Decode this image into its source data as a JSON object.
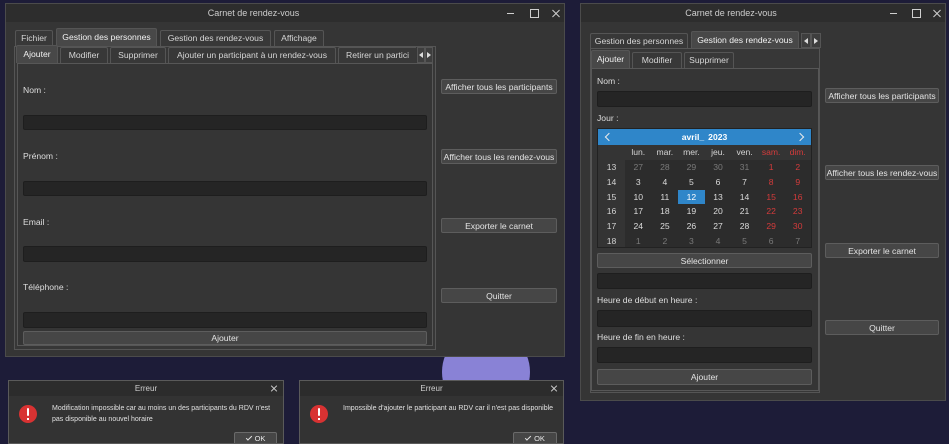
{
  "colors": {
    "accent": "#2f86c9",
    "weekend": "#d43b3b",
    "error": "#d83232",
    "desktop": "#1d1c38",
    "wallpaper_shape": "#8982d6"
  },
  "windows": {
    "left": {
      "title": "Carnet de rendez-vous",
      "controls": [
        "minimize-icon",
        "maximize-icon",
        "close-icon"
      ],
      "tabs": [
        {
          "label": "Fichier"
        },
        {
          "label": "Gestion des personnes",
          "selected": true
        },
        {
          "label": "Gestion des rendez-vous"
        },
        {
          "label": "Affichage"
        }
      ],
      "subtabs": [
        {
          "label": "Ajouter",
          "selected": true
        },
        {
          "label": "Modifier"
        },
        {
          "label": "Supprimer"
        },
        {
          "label": "Ajouter un participant à un rendez-vous"
        },
        {
          "label": "Retirer un partici"
        }
      ],
      "tab_scroll_icons": [
        "arrow-left-icon",
        "arrow-right-icon"
      ],
      "form": {
        "fields": [
          {
            "label": "Nom :"
          },
          {
            "label": "Prénom :"
          },
          {
            "label": "Email :"
          },
          {
            "label": "Téléphone :"
          }
        ],
        "submit_label": "Ajouter"
      },
      "side_buttons": [
        "Afficher tous les participants",
        "Afficher tous les rendez-vous",
        "Exporter le carnet",
        "Quitter"
      ]
    },
    "right": {
      "title": "Carnet de rendez-vous",
      "controls": [
        "minimize-icon",
        "maximize-icon",
        "close-icon"
      ],
      "tabs": [
        {
          "label": "Gestion des personnes"
        },
        {
          "label": "Gestion des rendez-vous",
          "selected": true
        }
      ],
      "tab_scroll_icons": [
        "arrow-left-icon",
        "arrow-right-icon"
      ],
      "subtabs": [
        {
          "label": "Ajouter",
          "selected": true
        },
        {
          "label": "Modifier"
        },
        {
          "label": "Supprimer"
        }
      ],
      "form": {
        "name_label": "Nom :",
        "day_label": "Jour :",
        "select_button": "Sélectionner",
        "start_label": "Heure de début en heure :",
        "end_label": "Heure de fin en heure :",
        "submit_label": "Ajouter"
      },
      "calendar": {
        "month": "avril_",
        "year": "2023",
        "nav_icons": [
          "chevron-left-icon",
          "chevron-right-icon"
        ],
        "weekdays": [
          "lun.",
          "mar.",
          "mer.",
          "jeu.",
          "ven.",
          "sam.",
          "dim."
        ],
        "weeks": [
          {
            "number": "13",
            "days": [
              {
                "d": "27",
                "state": "other"
              },
              {
                "d": "28",
                "state": "other"
              },
              {
                "d": "29",
                "state": "other"
              },
              {
                "d": "30",
                "state": "other"
              },
              {
                "d": "31",
                "state": "other"
              },
              {
                "d": "1",
                "state": "weekend"
              },
              {
                "d": "2",
                "state": "weekend"
              }
            ]
          },
          {
            "number": "14",
            "days": [
              {
                "d": "3"
              },
              {
                "d": "4"
              },
              {
                "d": "5"
              },
              {
                "d": "6"
              },
              {
                "d": "7"
              },
              {
                "d": "8",
                "state": "weekend"
              },
              {
                "d": "9",
                "state": "weekend"
              }
            ]
          },
          {
            "number": "15",
            "days": [
              {
                "d": "10"
              },
              {
                "d": "11"
              },
              {
                "d": "12",
                "state": "selected"
              },
              {
                "d": "13"
              },
              {
                "d": "14"
              },
              {
                "d": "15",
                "state": "weekend"
              },
              {
                "d": "16",
                "state": "weekend"
              }
            ]
          },
          {
            "number": "16",
            "days": [
              {
                "d": "17"
              },
              {
                "d": "18"
              },
              {
                "d": "19"
              },
              {
                "d": "20"
              },
              {
                "d": "21"
              },
              {
                "d": "22",
                "state": "weekend"
              },
              {
                "d": "23",
                "state": "weekend"
              }
            ]
          },
          {
            "number": "17",
            "days": [
              {
                "d": "24"
              },
              {
                "d": "25"
              },
              {
                "d": "26"
              },
              {
                "d": "27"
              },
              {
                "d": "28"
              },
              {
                "d": "29",
                "state": "weekend"
              },
              {
                "d": "30",
                "state": "weekend"
              }
            ]
          },
          {
            "number": "18",
            "days": [
              {
                "d": "1",
                "state": "other"
              },
              {
                "d": "2",
                "state": "other"
              },
              {
                "d": "3",
                "state": "other"
              },
              {
                "d": "4",
                "state": "other"
              },
              {
                "d": "5",
                "state": "other"
              },
              {
                "d": "6",
                "state": "other"
              },
              {
                "d": "7",
                "state": "other"
              }
            ]
          }
        ]
      },
      "side_buttons": [
        "Afficher tous les participants",
        "Afficher tous les rendez-vous",
        "Exporter le carnet",
        "Quitter"
      ]
    }
  },
  "dialogs": [
    {
      "title": "Erreur",
      "icon": "error-icon",
      "message_lines": [
        "Modification impossible car au moins un des participants du RDV n'est",
        "pas disponible au nouvel horaire"
      ],
      "button_icon": "check-icon",
      "button": "OK"
    },
    {
      "title": "Erreur",
      "icon": "error-icon",
      "message_lines": [
        "Impossible d'ajouter le participant au RDV car il n'est pas disponible"
      ],
      "button_icon": "check-icon",
      "button": "OK"
    }
  ]
}
